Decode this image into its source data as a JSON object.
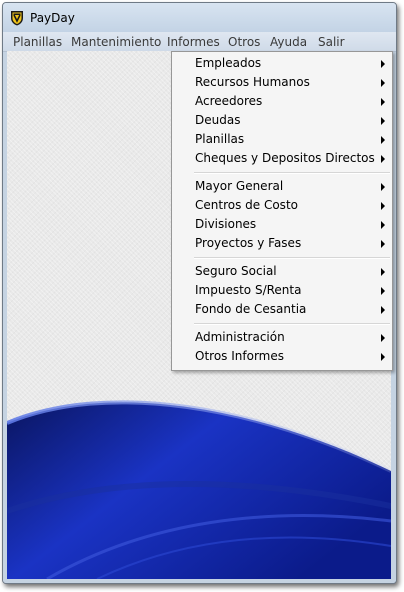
{
  "window": {
    "title": "PayDay",
    "icon": "payday-shield-icon"
  },
  "menubar": {
    "items": [
      "Planillas",
      "Mantenimiento",
      "Informes",
      "Otros",
      "Ayuda",
      "Salir"
    ]
  },
  "informes_menu": {
    "groups": [
      [
        "Empleados",
        "Recursos Humanos",
        "Acreedores",
        "Deudas",
        "Planillas",
        "Cheques y Depositos Directos"
      ],
      [
        "Mayor General",
        "Centros de Costo",
        "Divisiones",
        "Proyectos y Fases"
      ],
      [
        "Seguro Social",
        "Impuesto S/Renta",
        "Fondo de Cesantia"
      ],
      [
        "Administración",
        "Otros Informes"
      ]
    ],
    "submenu_indicator": "chevron-right-icon"
  },
  "colors": {
    "titlebar": "#c9d7e7",
    "menu_background": "#f5f5f5",
    "swoosh_dark": "#0a1a7a",
    "swoosh_mid": "#1d3fd0"
  }
}
